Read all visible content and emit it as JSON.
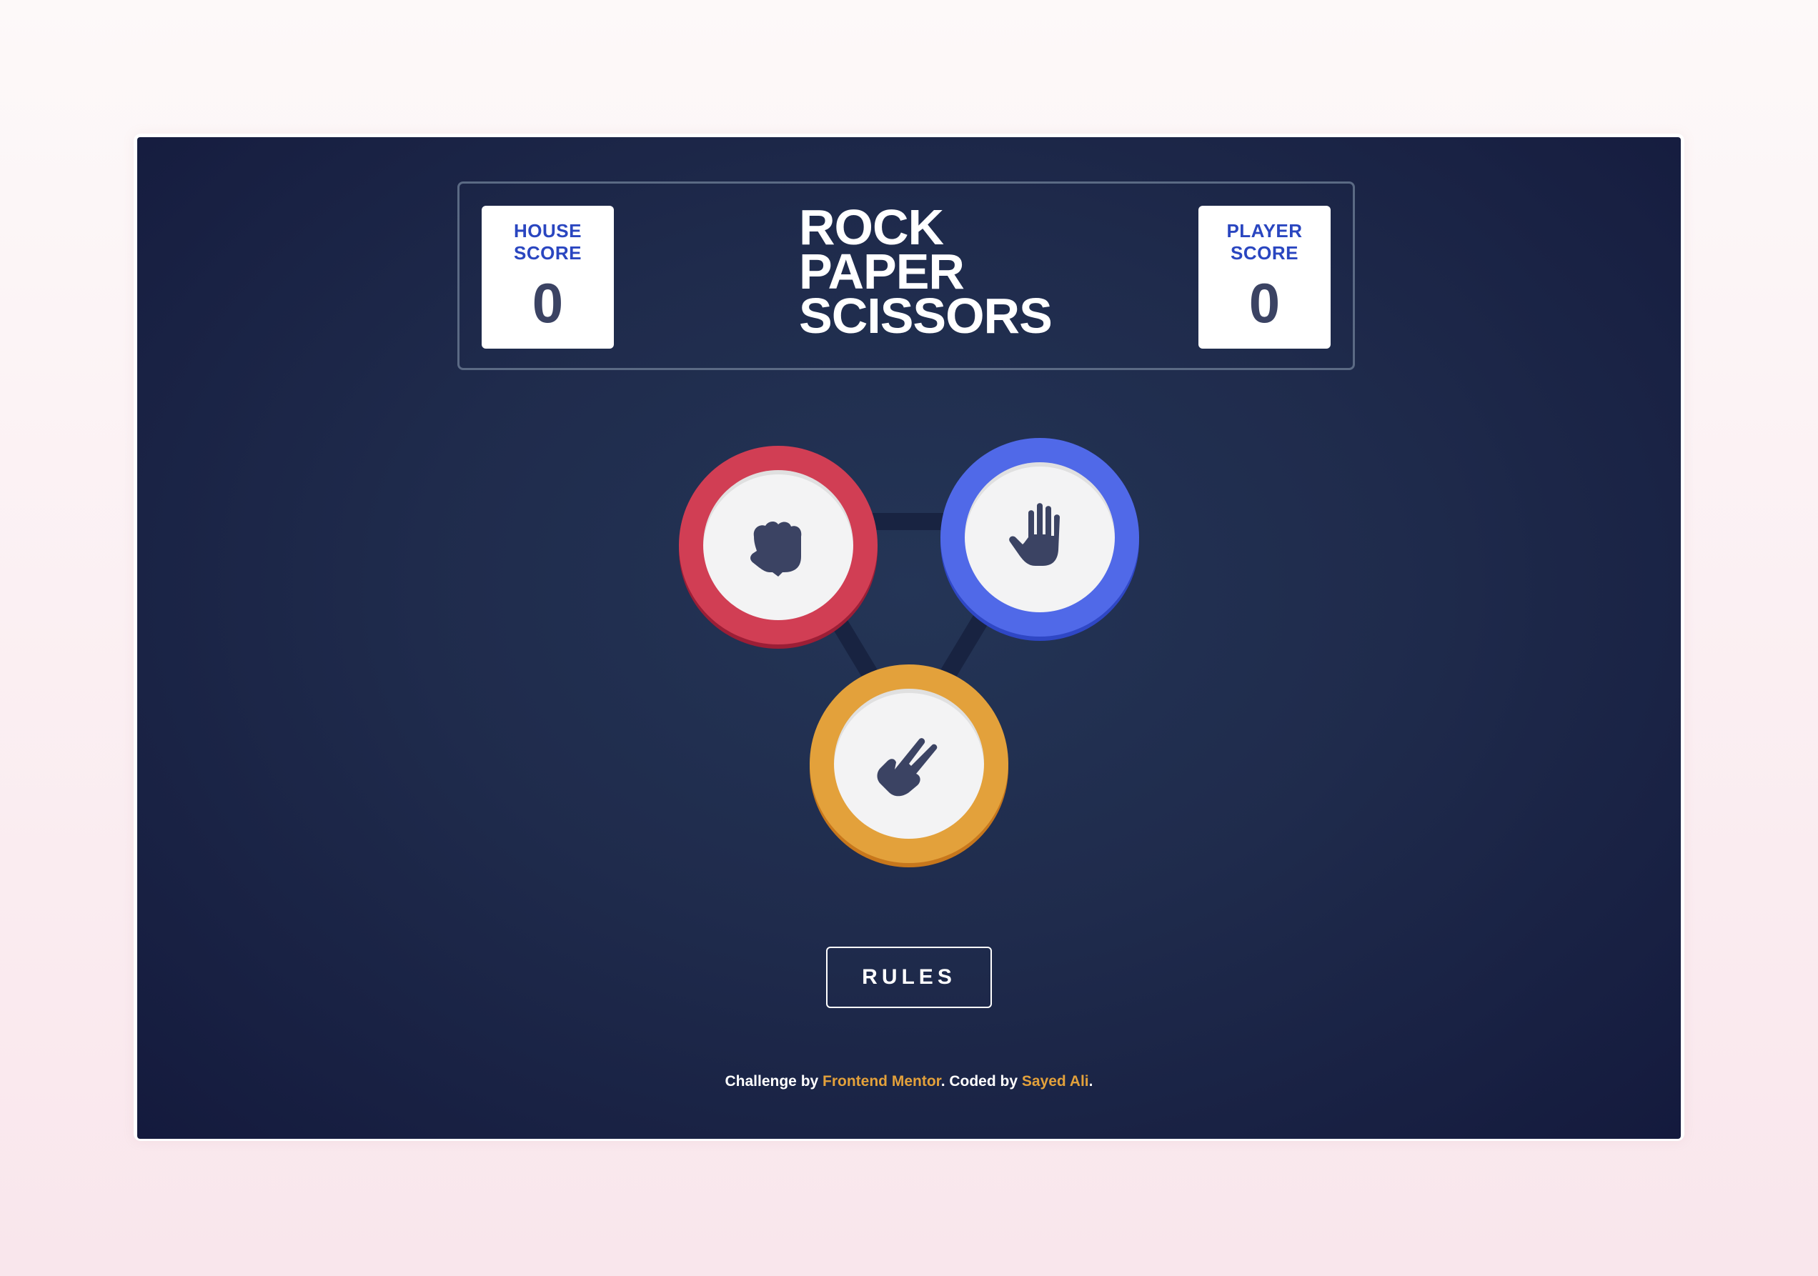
{
  "header": {
    "house_label": "HOUSE\nSCORE",
    "house_score": "0",
    "title": "ROCK\nPAPER\nSCISSORS",
    "player_label": "PLAYER\nSCORE",
    "player_score": "0"
  },
  "choices": [
    {
      "name": "rock",
      "icon": "rock-fist-icon",
      "color": "#d13e54"
    },
    {
      "name": "paper",
      "icon": "paper-hand-icon",
      "color": "#5069e8"
    },
    {
      "name": "scissors",
      "icon": "scissors-hand-icon",
      "color": "#e3a13b"
    }
  ],
  "rules_button": "RULES",
  "footer": {
    "prefix": "Challenge by ",
    "challenge_link": "Frontend Mentor",
    "middle": ". Coded by ",
    "author_link": "Sayed Ali",
    "suffix": "."
  },
  "colors": {
    "background": "#1f2b4c",
    "score_label": "#2a46c0",
    "score_value": "#3b4363",
    "accent_link": "#e3a13b"
  }
}
